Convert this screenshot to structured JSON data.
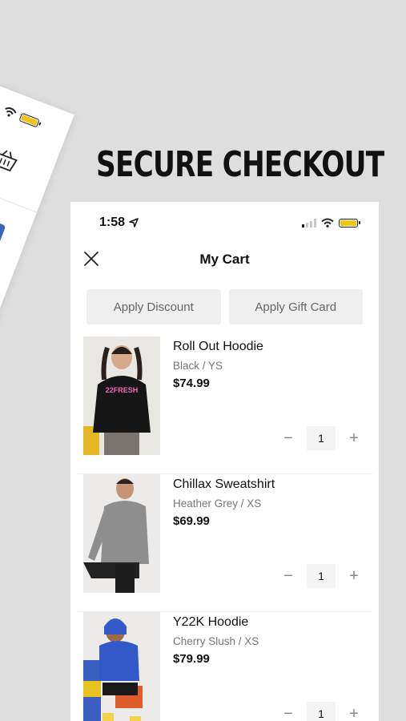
{
  "headline": "SECURE CHECKOUT",
  "status": {
    "time": "1:58"
  },
  "cart": {
    "title": "My Cart",
    "apply_discount_label": "Apply Discount",
    "apply_gift_card_label": "Apply Gift Card",
    "items": [
      {
        "name": "Roll Out Hoodie",
        "variant": "Black / YS",
        "price": "$74.99",
        "quantity": "1"
      },
      {
        "name": "Chillax Sweatshirt",
        "variant": "Heather Grey / XS",
        "price": "$69.99",
        "quantity": "1"
      },
      {
        "name": "Y22K Hoodie",
        "variant": "Cherry Slush / XS",
        "price": "$79.99",
        "quantity": "1"
      }
    ],
    "minus_label": "−",
    "plus_label": "+"
  },
  "colors": {
    "battery": "#f0c419",
    "accent_blue": "#3c63b7",
    "background": "#dedede"
  }
}
